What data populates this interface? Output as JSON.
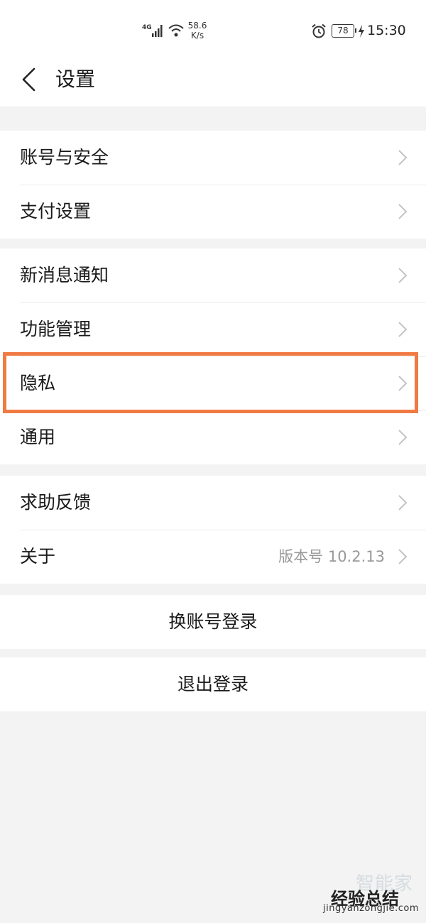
{
  "status_bar": {
    "network": "4G",
    "speed_value": "58.6",
    "speed_unit": "K/s",
    "battery": "78",
    "time": "15:30",
    "icons": [
      "signal-icon",
      "wifi-icon",
      "alarm-icon",
      "battery-icon",
      "charging-icon"
    ]
  },
  "header": {
    "title": "设置",
    "back_icon": "back-arrow-icon"
  },
  "groups": [
    {
      "items": [
        {
          "label": "账号与安全"
        },
        {
          "label": "支付设置"
        }
      ]
    },
    {
      "items": [
        {
          "label": "新消息通知"
        },
        {
          "label": "功能管理"
        },
        {
          "label": "隐私"
        },
        {
          "label": "通用"
        }
      ]
    },
    {
      "items": [
        {
          "label": "求助反馈"
        },
        {
          "label": "关于",
          "value": "版本号 10.2.13"
        }
      ]
    }
  ],
  "actions": {
    "switch_account": "换账号登录",
    "logout": "退出登录"
  },
  "highlight": {
    "target": "隐私",
    "color": "#f07a43"
  },
  "watermark": {
    "ghost": "智能家",
    "main": "经验总结",
    "url": "jingyanzongjie.com"
  }
}
